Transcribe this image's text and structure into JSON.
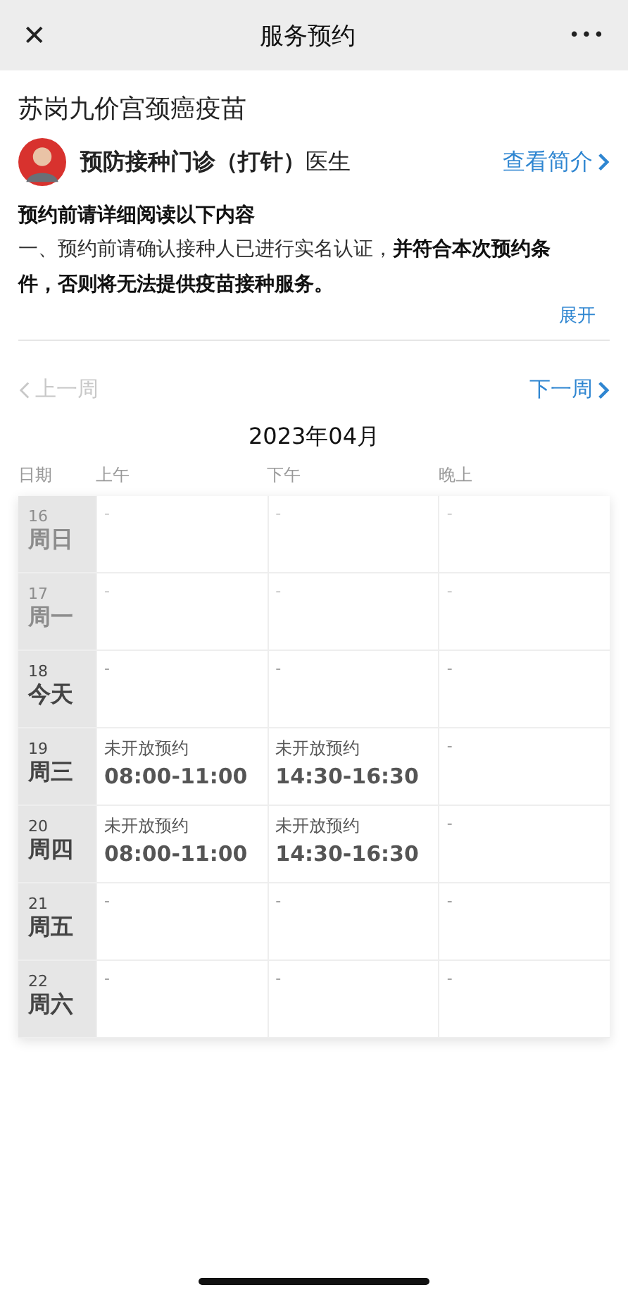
{
  "nav_bar": {
    "close_glyph": "✕",
    "title": "服务预约",
    "more_glyph": "•••"
  },
  "service": {
    "title": "苏岗九价宫颈癌疫苗",
    "department": "预防接种门诊（打针）",
    "role": "医生",
    "profile_link": "查看简介"
  },
  "notice": {
    "heading": "预约前请详细阅读以下内容",
    "body": "一、预约前请确认接种人已进行实名认证，**并符合本次预约条件，否则将无法提供疫苗接种服务。**",
    "expand": "展开"
  },
  "week_nav": {
    "prev": {
      "label": "上一周",
      "disabled": true
    },
    "next": {
      "label": "下一周",
      "disabled": false
    }
  },
  "month": "2023年04月",
  "table": {
    "date_column": "日期",
    "columns": [
      "上午",
      "下午",
      "晚上"
    ],
    "rows": [
      {
        "date": "16",
        "weekday": "周日",
        "past": true,
        "cells": [
          {
            "kind": "empty",
            "text": "-"
          },
          {
            "kind": "empty",
            "text": "-"
          },
          {
            "kind": "empty",
            "text": "-"
          }
        ]
      },
      {
        "date": "17",
        "weekday": "周一",
        "past": true,
        "cells": [
          {
            "kind": "empty",
            "text": "-"
          },
          {
            "kind": "empty",
            "text": "-"
          },
          {
            "kind": "empty",
            "text": "-"
          }
        ]
      },
      {
        "date": "18",
        "weekday": "今天",
        "past": false,
        "cells": [
          {
            "kind": "empty",
            "text": "-"
          },
          {
            "kind": "empty",
            "text": "-"
          },
          {
            "kind": "empty",
            "text": "-"
          }
        ]
      },
      {
        "date": "19",
        "weekday": "周三",
        "past": false,
        "cells": [
          {
            "kind": "slot",
            "status": "未开放预约",
            "time": "08:00-11:00"
          },
          {
            "kind": "slot",
            "status": "未开放预约",
            "time": "14:30-16:30"
          },
          {
            "kind": "empty",
            "text": "-"
          }
        ]
      },
      {
        "date": "20",
        "weekday": "周四",
        "past": false,
        "cells": [
          {
            "kind": "slot",
            "status": "未开放预约",
            "time": "08:00-11:00"
          },
          {
            "kind": "slot",
            "status": "未开放预约",
            "time": "14:30-16:30"
          },
          {
            "kind": "empty",
            "text": "-"
          }
        ]
      },
      {
        "date": "21",
        "weekday": "周五",
        "past": false,
        "cells": [
          {
            "kind": "empty",
            "text": "-"
          },
          {
            "kind": "empty",
            "text": "-"
          },
          {
            "kind": "empty",
            "text": "-"
          }
        ]
      },
      {
        "date": "22",
        "weekday": "周六",
        "past": false,
        "cells": [
          {
            "kind": "empty",
            "text": "-"
          },
          {
            "kind": "empty",
            "text": "-"
          },
          {
            "kind": "empty",
            "text": "-"
          }
        ]
      }
    ]
  }
}
